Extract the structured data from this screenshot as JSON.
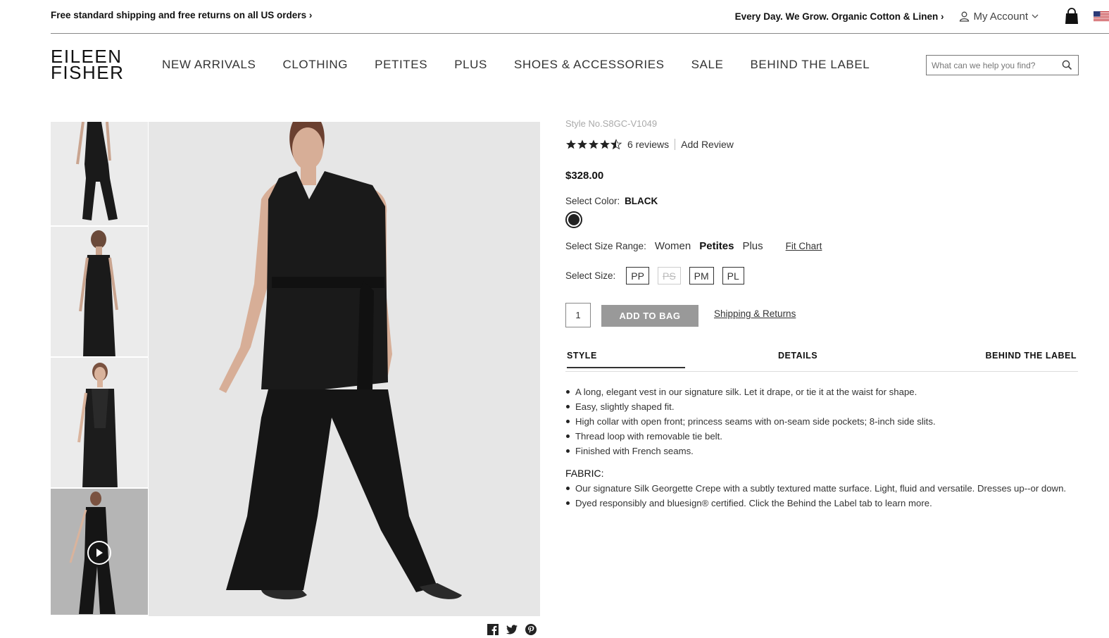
{
  "topbar": {
    "promo": "Free standard shipping and free returns on all US orders ›",
    "tagline": "Every Day. We Grow. Organic Cotton & Linen  ›",
    "account": "My Account"
  },
  "header": {
    "logo_line1": "EILEEN",
    "logo_line2": "FISHER",
    "nav": [
      "NEW ARRIVALS",
      "CLOTHING",
      "PETITES",
      "PLUS",
      "SHOES & ACCESSORIES",
      "SALE",
      "BEHIND THE LABEL"
    ],
    "search_placeholder": "What can we help you find?"
  },
  "product": {
    "style_no": "Style No.S8GC-V1049",
    "rating": 4.5,
    "reviews": "6 reviews",
    "add_review": "Add Review",
    "price": "$328.00",
    "color_label": "Select Color:",
    "color_value": "BLACK",
    "range_label": "Select Size Range:",
    "ranges": [
      "Women",
      "Petites",
      "Plus"
    ],
    "selected_range": "Petites",
    "fit_chart": "Fit Chart",
    "size_label": "Select Size:",
    "sizes": [
      "PP",
      "PS",
      "PM",
      "PL"
    ],
    "unavailable_size": "PS",
    "quantity": "1",
    "add_to_bag": "ADD TO BAG",
    "shipping": "Shipping & Returns"
  },
  "tabs": [
    "STYLE",
    "DETAILS",
    "BEHIND THE LABEL"
  ],
  "description": {
    "bullets": [
      "A long, elegant vest in our signature silk. Let it drape, or tie it at the waist for shape.",
      "Easy, slightly shaped fit.",
      "High collar with open front; princess seams with on-seam side pockets; 8-inch side slits.",
      "Thread loop with removable tie belt.",
      "Finished with French seams."
    ],
    "fabric_heading": "FABRIC:",
    "fabric_bullets": [
      "Our signature Silk Georgette Crepe with a subtly textured matte surface. Light, fluid and versatile. Dresses up--or down.",
      "Dyed responsibly and bluesign® certified. Click the Behind the Label tab to learn more."
    ]
  },
  "colors": {
    "accent": "#222222",
    "button_disabled": "#999999",
    "image_bg": "#e6e6e6"
  }
}
